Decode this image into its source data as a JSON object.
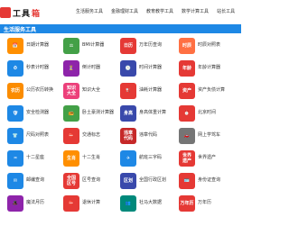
{
  "header": {
    "logo_text": "工具",
    "logo_suffix": "箱",
    "nav": [
      "生活服务工具",
      "金融理财工具",
      "教育教学工具",
      "数学计算工具",
      "站长工具"
    ]
  },
  "section_title": "生活服务工具",
  "tools": [
    [
      {
        "label": "日期计算器",
        "icon": "calendar-icon",
        "color": "#ff8f00",
        "glyph": "📅"
      },
      {
        "label": "BMI计算器",
        "icon": "bmi-scale-icon",
        "color": "#43a047",
        "glyph": "⚖"
      },
      {
        "label": "万年历查询",
        "icon": "perpetual-calendar-icon",
        "color": "#e53935",
        "glyph": "日历"
      },
      {
        "label": "时辰对照表",
        "icon": "shichen-icon",
        "color": "#ff7043",
        "glyph": "时辰"
      }
    ],
    [
      {
        "label": "秒表计时器",
        "icon": "stopwatch-icon",
        "color": "#1e88e5",
        "glyph": "⏱"
      },
      {
        "label": "倒计时器",
        "icon": "countdown-icon",
        "color": "#8e24aa",
        "glyph": "⏳"
      },
      {
        "label": "时间计算器",
        "icon": "clock-icon",
        "color": "#3949ab",
        "glyph": "🕓"
      },
      {
        "label": "年龄计算器",
        "icon": "age-icon",
        "color": "#e53935",
        "glyph": "年龄"
      }
    ],
    [
      {
        "label": "公历农历转换",
        "icon": "calendar-convert-icon",
        "color": "#fb8c00",
        "glyph": "农历"
      },
      {
        "label": "知识大全",
        "icon": "knowledge-icon",
        "color": "#ec407a",
        "glyph": "知识\n大全"
      },
      {
        "label": "油耗计算器",
        "icon": "fuel-icon",
        "color": "#e53935",
        "glyph": "⛽"
      },
      {
        "label": "资产负债计算",
        "icon": "assets-icon",
        "color": "#e53935",
        "glyph": "资产"
      }
    ],
    [
      {
        "label": "安全检测器",
        "icon": "safety-icon",
        "color": "#1e88e5",
        "glyph": "🛡"
      },
      {
        "label": "卧土豪测计算器",
        "icon": "radio-icon",
        "color": "#43a047",
        "glyph": "📻"
      },
      {
        "label": "身高体重计算",
        "icon": "height-weight-icon",
        "color": "#3949ab",
        "glyph": "身高"
      },
      {
        "label": "北京时间",
        "icon": "beijing-time-icon",
        "color": "#e53935",
        "glyph": "⏰"
      }
    ],
    [
      {
        "label": "尺码对照表",
        "icon": "size-chart-icon",
        "color": "#1e88e5",
        "glyph": "👕"
      },
      {
        "label": "交通标志",
        "icon": "traffic-sign-icon",
        "color": "#e53935",
        "glyph": "⛔"
      },
      {
        "label": "违章代码",
        "icon": "violation-code-icon",
        "color": "#c62828",
        "glyph": "违章\n代码"
      },
      {
        "label": "网上学驾车",
        "icon": "driving-icon",
        "color": "#757575",
        "glyph": "🚗"
      }
    ],
    [
      {
        "label": "十二星座",
        "icon": "zodiac-icon",
        "color": "#1e88e5",
        "glyph": "♒"
      },
      {
        "label": "十二生肖",
        "icon": "chinese-zodiac-icon",
        "color": "#ff8f00",
        "glyph": "生肖"
      },
      {
        "label": "航班三字码",
        "icon": "flight-icon",
        "color": "#1e88e5",
        "glyph": "✈"
      },
      {
        "label": "世界遗产",
        "icon": "world-heritage-icon",
        "color": "#e53935",
        "glyph": "世界\n遗产"
      }
    ],
    [
      {
        "label": "邮编查询",
        "icon": "postcode-icon",
        "color": "#1e88e5",
        "glyph": "✉"
      },
      {
        "label": "区号查询",
        "icon": "area-code-icon",
        "color": "#e53935",
        "glyph": "全国\n区号"
      },
      {
        "label": "全国行政区划",
        "icon": "division-icon",
        "color": "#3949ab",
        "glyph": "区划"
      },
      {
        "label": "身份证查询",
        "icon": "id-card-icon",
        "color": "#e53935",
        "glyph": "🪪"
      }
    ],
    [
      {
        "label": "魔法月历",
        "icon": "magic-calendar-icon",
        "color": "#8e24aa",
        "glyph": "🎩"
      },
      {
        "label": "退休计算",
        "icon": "retire-icon",
        "color": "#e53935",
        "glyph": "⛔"
      },
      {
        "label": "社马大数据",
        "icon": "data-icon",
        "color": "#00897b",
        "glyph": "👥"
      },
      {
        "label": "万年历",
        "icon": "almanac-icon",
        "color": "#e53935",
        "glyph": "万年历"
      }
    ]
  ]
}
